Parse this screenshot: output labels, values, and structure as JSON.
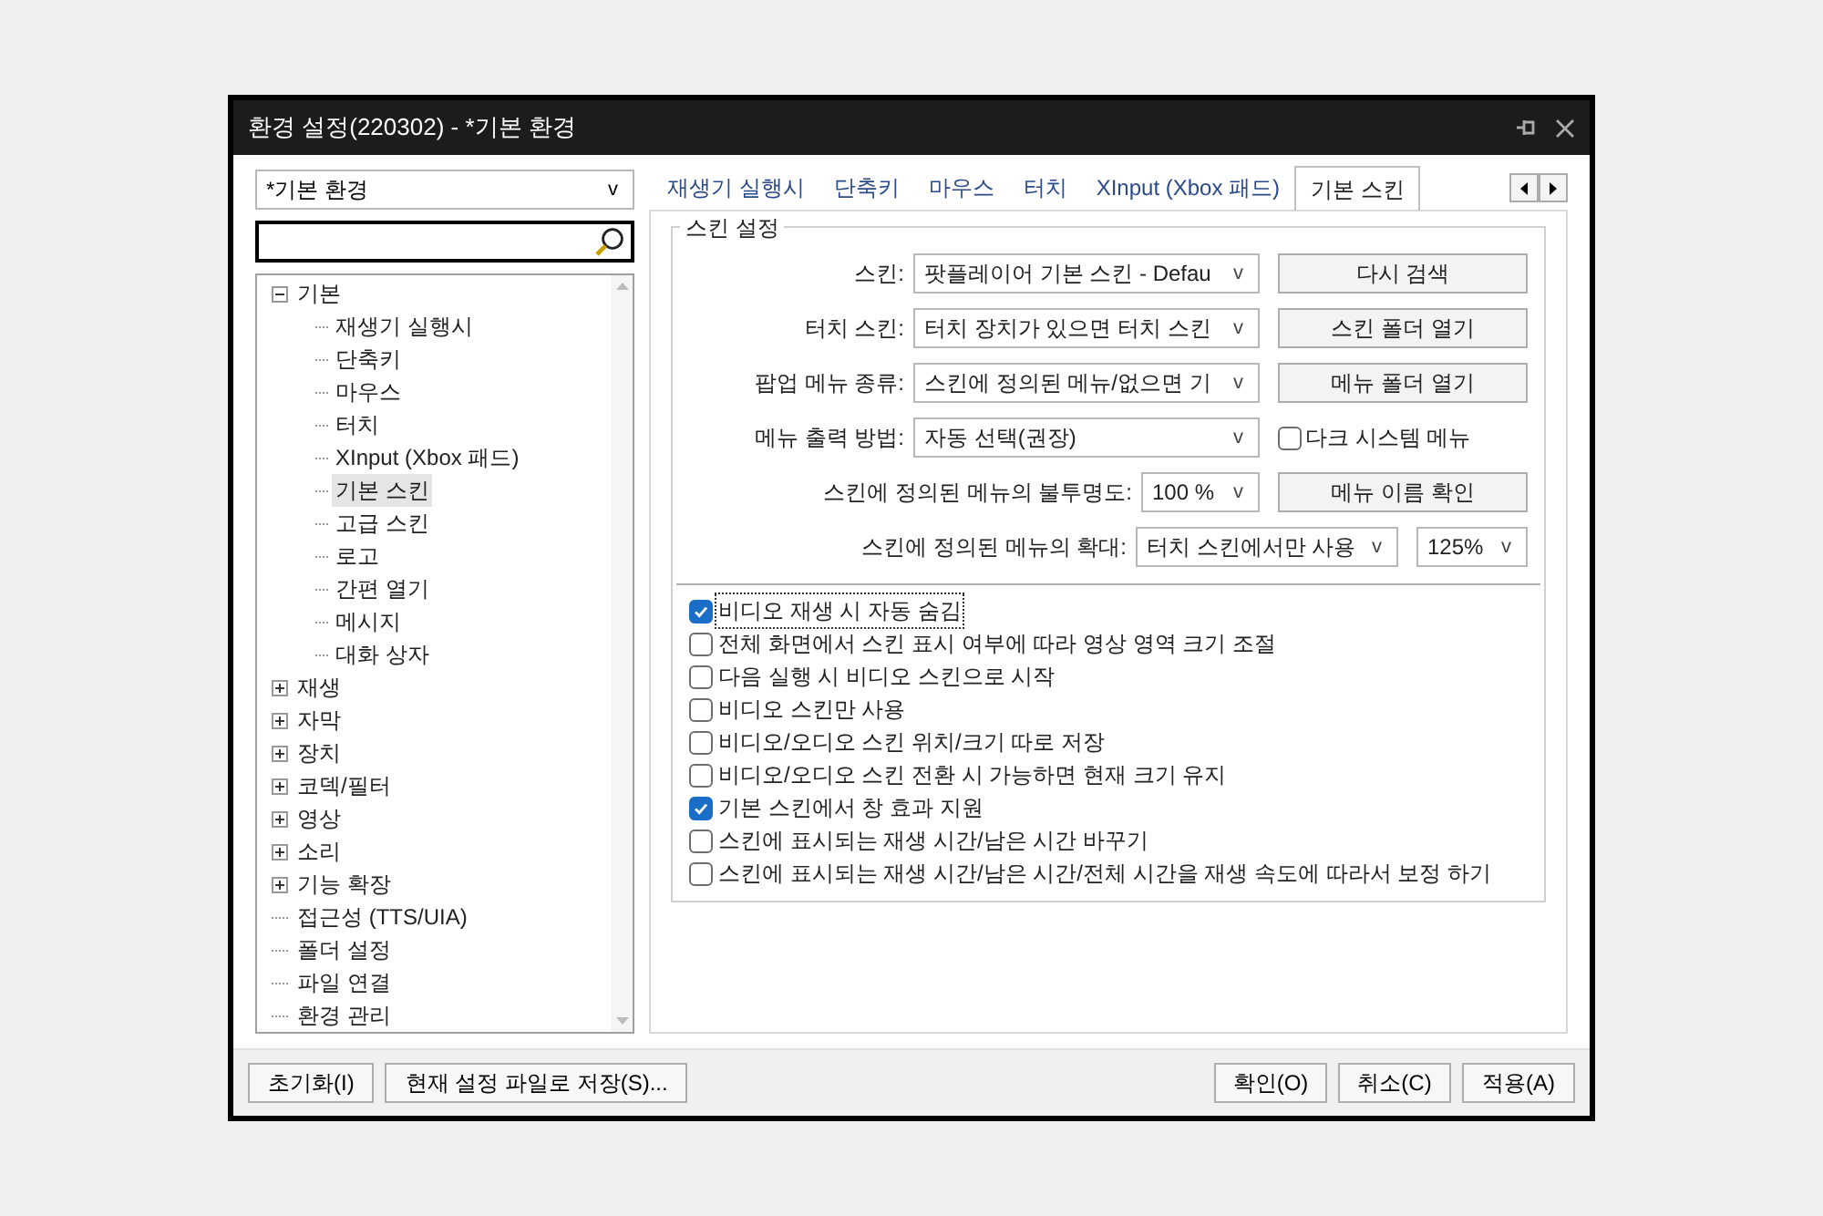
{
  "window": {
    "title": "환경 설정(220302) - *기본 환경"
  },
  "profile": {
    "value": "*기본 환경",
    "arrow": "v"
  },
  "tree": [
    {
      "label": "기본",
      "expanded": true,
      "selected": false,
      "children": [
        {
          "label": "재생기 실행시",
          "selected": false
        },
        {
          "label": "단축키",
          "selected": false
        },
        {
          "label": "마우스",
          "selected": false
        },
        {
          "label": "터치",
          "selected": false
        },
        {
          "label": "XInput (Xbox 패드)",
          "selected": false
        },
        {
          "label": "기본 스킨",
          "selected": true
        },
        {
          "label": "고급 스킨",
          "selected": false
        },
        {
          "label": "로고",
          "selected": false
        },
        {
          "label": "간편 열기",
          "selected": false
        },
        {
          "label": "메시지",
          "selected": false
        },
        {
          "label": "대화 상자",
          "selected": false
        }
      ]
    },
    {
      "label": "재생",
      "expanded": false,
      "selected": false
    },
    {
      "label": "자막",
      "expanded": false,
      "selected": false
    },
    {
      "label": "장치",
      "expanded": false,
      "selected": false
    },
    {
      "label": "코덱/필터",
      "expanded": false,
      "selected": false
    },
    {
      "label": "영상",
      "expanded": false,
      "selected": false
    },
    {
      "label": "소리",
      "expanded": false,
      "selected": false
    },
    {
      "label": "기능 확장",
      "expanded": false,
      "selected": false
    },
    {
      "label": "접근성 (TTS/UIA)",
      "selected": false
    },
    {
      "label": "폴더 설정",
      "selected": false
    },
    {
      "label": "파일 연결",
      "selected": false
    },
    {
      "label": "환경 관리",
      "selected": false
    }
  ],
  "tabs": [
    {
      "label": "재생기 실행시",
      "selected": false
    },
    {
      "label": "단축키",
      "selected": false
    },
    {
      "label": "마우스",
      "selected": false
    },
    {
      "label": "터치",
      "selected": false
    },
    {
      "label": "XInput (Xbox 패드)",
      "selected": false
    },
    {
      "label": "기본 스킨",
      "selected": true
    }
  ],
  "group": {
    "title": "스킨 설정"
  },
  "rows": [
    {
      "label": "스킨:",
      "controls": [
        {
          "kind": "select",
          "value": "팟플레이어 기본 스킨 - Defau",
          "arrow": "v"
        },
        {
          "kind": "button",
          "label": "다시 검색"
        }
      ]
    },
    {
      "label": "터치 스킨:",
      "controls": [
        {
          "kind": "select",
          "value": "터치 장치가 있으면 터치 스킨",
          "arrow": "v"
        },
        {
          "kind": "button",
          "label": "스킨 폴더 열기"
        }
      ]
    },
    {
      "label": "팝업 메뉴 종류:",
      "controls": [
        {
          "kind": "select",
          "value": "스킨에 정의된 메뉴/없으면 기",
          "arrow": "v"
        },
        {
          "kind": "button",
          "label": "메뉴 폴더 열기"
        }
      ]
    },
    {
      "label": "메뉴 출력 방법:",
      "controls": [
        {
          "kind": "select",
          "value": "자동 선택(권장)",
          "arrow": "v"
        },
        {
          "kind": "checkbox",
          "label": "다크 시스템 메뉴",
          "checked": false
        }
      ]
    },
    {
      "label": "스킨에 정의된 메뉴의 불투명도:",
      "controls": [
        {
          "kind": "select",
          "value": "100 %",
          "arrow": "v"
        },
        {
          "kind": "button",
          "label": "메뉴 이름 확인"
        }
      ]
    },
    {
      "label": "스킨에 정의된 메뉴의 확대:",
      "controls": [
        {
          "kind": "select",
          "value": "터치 스킨에서만 사용",
          "arrow": "v"
        },
        {
          "kind": "select",
          "value": "125%",
          "arrow": "v"
        }
      ]
    }
  ],
  "options": [
    {
      "label": "비디오 재생 시 자동 숨김",
      "checked": true,
      "focused": true
    },
    {
      "label": "전체 화면에서 스킨 표시 여부에 따라 영상 영역 크기 조절",
      "checked": false,
      "focused": false
    },
    {
      "label": "다음 실행 시 비디오 스킨으로 시작",
      "checked": false,
      "focused": false
    },
    {
      "label": "비디오 스킨만 사용",
      "checked": false,
      "focused": false
    },
    {
      "label": "비디오/오디오 스킨 위치/크기 따로 저장",
      "checked": false,
      "focused": false
    },
    {
      "label": "비디오/오디오 스킨 전환 시 가능하면 현재 크기 유지",
      "checked": false,
      "focused": false
    },
    {
      "label": "기본 스킨에서 창 효과 지원",
      "checked": true,
      "focused": false
    },
    {
      "label": "스킨에 표시되는 재생 시간/남은 시간 바꾸기",
      "checked": false,
      "focused": false
    },
    {
      "label": "스킨에 표시되는 재생 시간/남은 시간/전체 시간을 재생 속도에 따라서 보정 하기",
      "checked": false,
      "focused": false
    }
  ],
  "footer": {
    "left": [
      "초기화(I)",
      "현재 설정 파일로 저장(S)..."
    ],
    "right": [
      "확인(O)",
      "취소(C)",
      "적용(A)"
    ]
  }
}
